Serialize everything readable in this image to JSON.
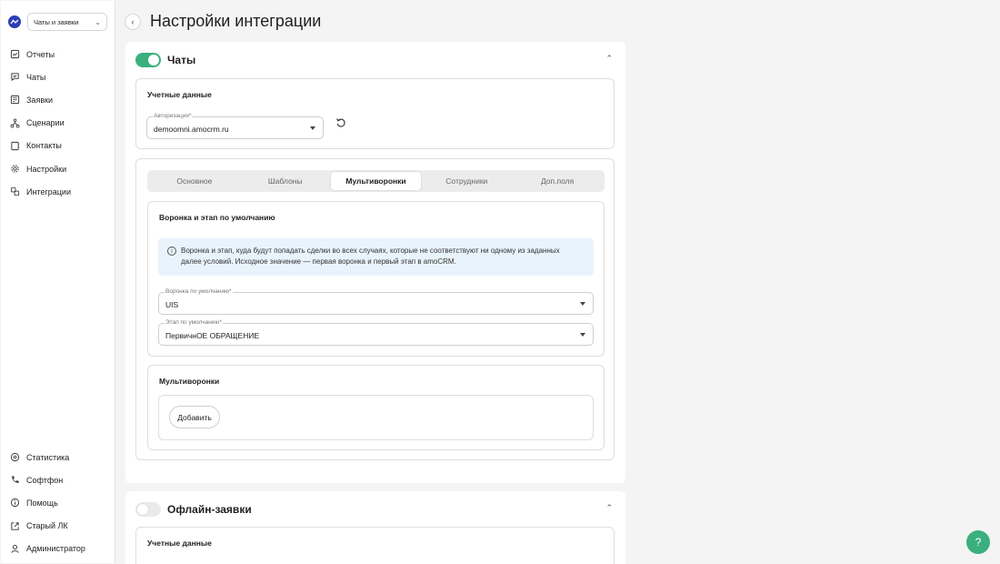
{
  "sidebar": {
    "workspace": "Чаты и заявки",
    "items": [
      {
        "label": "Отчеты",
        "icon": "reports-icon"
      },
      {
        "label": "Чаты",
        "icon": "chat-icon"
      },
      {
        "label": "Заявки",
        "icon": "requests-icon"
      },
      {
        "label": "Сценарии",
        "icon": "scenarios-icon"
      },
      {
        "label": "Контакты",
        "icon": "contacts-icon"
      },
      {
        "label": "Настройки",
        "icon": "gear-icon"
      },
      {
        "label": "Интеграции",
        "icon": "integrations-icon"
      }
    ],
    "bottom_items": [
      {
        "label": "Статистика",
        "icon": "statistics-icon"
      },
      {
        "label": "Софтфон",
        "icon": "phone-icon"
      },
      {
        "label": "Помощь",
        "icon": "help-icon"
      },
      {
        "label": "Старый ЛК",
        "icon": "external-link-icon"
      },
      {
        "label": "Администратор",
        "icon": "user-icon"
      }
    ]
  },
  "page": {
    "title": "Настройки интеграции"
  },
  "chats": {
    "title": "Чаты",
    "enabled": true,
    "credentials": {
      "title": "Учетные данные",
      "auth_label": "Авторизация*",
      "auth_value": "demoomni.amocrm.ru"
    },
    "tabs": [
      "Основное",
      "Шаблоны",
      "Мультиворонки",
      "Сотрудники",
      "Доп.поля"
    ],
    "active_tab": 2,
    "default_section": {
      "title": "Воронка и этап по умолчанию",
      "info": "Воронка и этап, куда будут попадать сделки во всех случаях, которые не соответствуют ни одному из заданных далее условий. Исходное значение — первая воронка и первый этап в amoCRM.",
      "funnel_label": "Воронка по умолчанию*",
      "funnel_value": "UIS",
      "stage_label": "Этап по умолчанию*",
      "stage_value": "ПервичнОЕ ОБРАЩЕНИЕ"
    },
    "multifunnels": {
      "title": "Мультиворонки",
      "add_label": "Добавить"
    }
  },
  "offline": {
    "title": "Офлайн-заявки",
    "enabled": false,
    "credentials_title": "Учетные данные"
  },
  "help_button": "?",
  "colors": {
    "accent": "#3bb07e",
    "info_bg": "#e9f3fb",
    "logo": "#2b3fb6"
  }
}
